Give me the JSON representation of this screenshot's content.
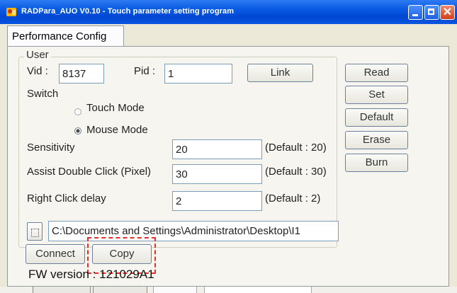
{
  "window": {
    "title": "RADPara_AUO V0.10 - Touch parameter setting program",
    "icon": "app-icon",
    "controls": [
      "minimize-icon",
      "maximize-icon",
      "close-icon"
    ]
  },
  "tabs": [
    {
      "label": "Performance Config",
      "active": true
    }
  ],
  "user_group": {
    "label": "User",
    "vid_label": "Vid :",
    "vid_value": "8137",
    "pid_label": "Pid :",
    "pid_value": "1",
    "link_label": "Link"
  },
  "switch": {
    "label": "Switch",
    "options": [
      {
        "label": "Touch Mode",
        "selected": false
      },
      {
        "label": "Mouse Mode",
        "selected": true
      }
    ]
  },
  "settings": [
    {
      "label": "Sensitivity",
      "value": "20",
      "default": "(Default : 20)"
    },
    {
      "label": "Assist Double Click (Pixel)",
      "value": "30",
      "default": "(Default : 30)"
    },
    {
      "label": "Right Click delay",
      "value": "2",
      "default": "(Default : 2)"
    }
  ],
  "side_buttons": [
    "Read",
    "Set",
    "Default",
    "Erase",
    "Burn"
  ],
  "file": {
    "path": "C:\\Documents and Settings\\Administrator\\Desktop\\I1",
    "browse_label": ""
  },
  "actions": {
    "connect": "Connect",
    "copy": "Copy"
  },
  "fw_version": "FW version :   121029A1",
  "annotation_color": "#e2302a"
}
